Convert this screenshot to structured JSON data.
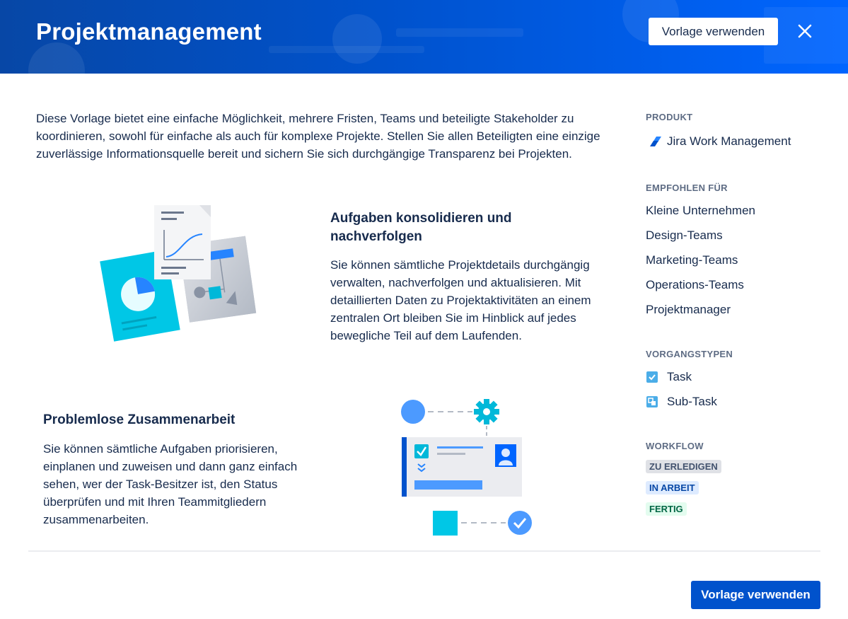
{
  "header": {
    "title": "Projektmanagement",
    "use_template_label": "Vorlage verwenden",
    "close_icon": "close-icon"
  },
  "intro": "Diese Vorlage bietet eine einfache Möglichkeit, mehrere Fristen, Teams und beteiligte Stakeholder zu koordinieren, sowohl für einfache als auch für komplexe Projekte. Stellen Sie allen Beteiligten eine einzige zuverlässige Informationsquelle bereit und sichern Sie sich durchgängige Transparenz bei Projekten.",
  "features": [
    {
      "title": "Aufgaben konsolidieren und nachverfolgen",
      "text": "Sie können sämtliche Projektdetails durchgängig verwalten, nachverfolgen und aktualisieren. Mit detaillierten Daten zu Projektaktivitäten an einem zentralen Ort bleiben Sie im Hinblick auf jedes bewegliche Teil auf dem Laufenden.",
      "illustration": "documents-illustration"
    },
    {
      "title": "Problemlose Zusammenarbeit",
      "text": "Sie können sämtliche Aufgaben priorisieren, einplanen und zuweisen und dann ganz einfach sehen, wer der Task-Besitzer ist, den Status überprüfen und mit Ihren Teammitgliedern zusammenarbeiten.",
      "illustration": "collaboration-illustration"
    }
  ],
  "sidebar": {
    "product_heading": "PRODUKT",
    "product_name": "Jira Work Management",
    "product_icon": "jira-logo-icon",
    "recommended_heading": "EMPFOHLEN FÜR",
    "recommended": [
      "Kleine Unternehmen",
      "Design-Teams",
      "Marketing-Teams",
      "Operations-Teams",
      "Projektmanager"
    ],
    "issue_types_heading": "VORGANGSTYPEN",
    "issue_types": [
      {
        "label": "Task",
        "icon": "task-checkbox-icon"
      },
      {
        "label": "Sub-Task",
        "icon": "subtask-icon"
      }
    ],
    "workflow_heading": "WORKFLOW",
    "workflow": [
      {
        "label": "ZU ERLEDIGEN",
        "bg": "#DFE1E6",
        "fg": "#42526E"
      },
      {
        "label": "IN ARBEIT",
        "bg": "#DEEBFF",
        "fg": "#0747A6"
      },
      {
        "label": "FERTIG",
        "bg": "#E3FCEF",
        "fg": "#006644"
      }
    ]
  },
  "footer": {
    "use_template_label": "Vorlage verwenden"
  },
  "colors": {
    "brand_blue": "#0052CC",
    "header_dark": "#0747A6",
    "text": "#172B4D",
    "subtle": "#5E6C84"
  }
}
